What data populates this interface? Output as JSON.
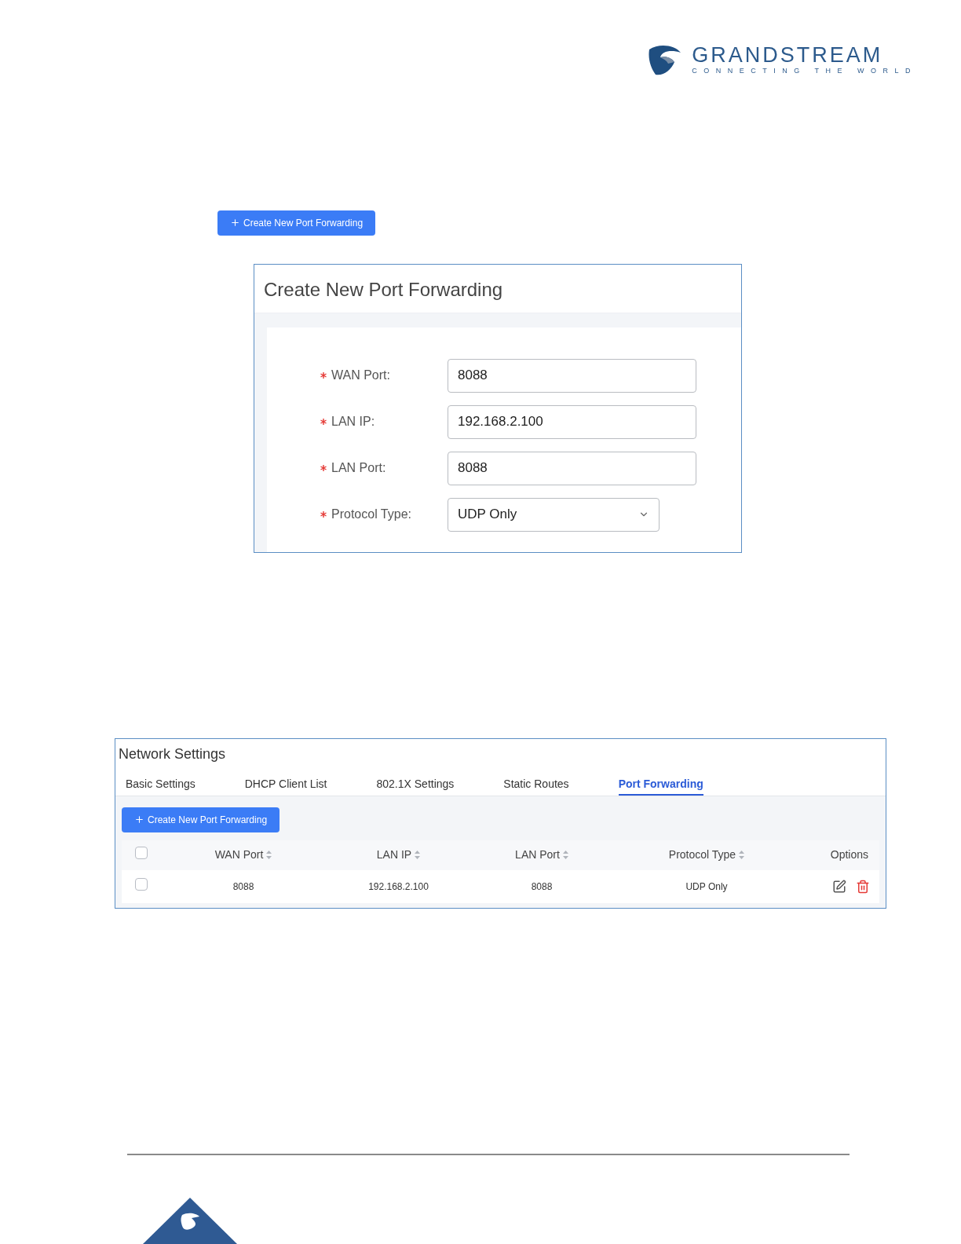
{
  "logo": {
    "name": "GRANDSTREAM",
    "tagline": "CONNECTING THE WORLD"
  },
  "create_button": {
    "label": "Create New Port Forwarding"
  },
  "dialog": {
    "title": "Create New Port Forwarding",
    "fields": [
      {
        "label": "WAN Port:",
        "value": "8088",
        "kind": "text",
        "required": true
      },
      {
        "label": "LAN IP:",
        "value": "192.168.2.100",
        "kind": "text",
        "required": true
      },
      {
        "label": "LAN Port:",
        "value": "8088",
        "kind": "text",
        "required": true
      },
      {
        "label": "Protocol Type:",
        "value": "UDP Only",
        "kind": "select",
        "required": true
      }
    ]
  },
  "network_settings": {
    "title": "Network Settings",
    "tabs": [
      {
        "label": "Basic Settings",
        "selected": false
      },
      {
        "label": "DHCP Client List",
        "selected": false
      },
      {
        "label": "802.1X Settings",
        "selected": false
      },
      {
        "label": "Static Routes",
        "selected": false
      },
      {
        "label": "Port Forwarding",
        "selected": true
      }
    ],
    "create_button": {
      "label": "Create New Port Forwarding"
    },
    "table": {
      "header_checked": false,
      "columns": [
        "WAN Port",
        "LAN IP",
        "LAN Port",
        "Protocol Type",
        "Options"
      ],
      "rows": [
        {
          "checked": false,
          "cells": [
            "8088",
            "192.168.2.100",
            "8088",
            "UDP Only"
          ]
        }
      ]
    }
  }
}
